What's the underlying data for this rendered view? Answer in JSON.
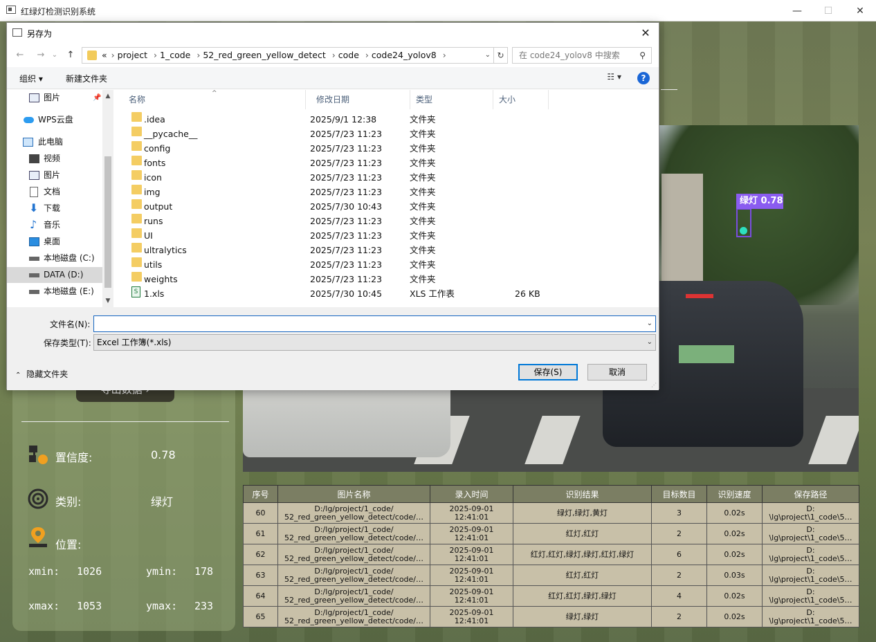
{
  "window": {
    "title": "红绿灯检测识别系统",
    "min_glyph": "—",
    "max_glyph": "☐",
    "close_glyph": "✕"
  },
  "app": {
    "export_button": "导出数据 ›",
    "confidence_label": "置信度:",
    "confidence_value": "0.78",
    "class_label": "类别:",
    "class_value": "绿灯",
    "position_label": "位置:",
    "xmin_label": "xmin:",
    "xmin_value": "1026",
    "ymin_label": "ymin:",
    "ymin_value": "178",
    "xmax_label": "xmax:",
    "xmax_value": "1053",
    "ymax_label": "ymax:",
    "ymax_value": "233",
    "detection_label": "绿灯 0.78",
    "table": {
      "headers": [
        "序号",
        "图片名称",
        "录入时间",
        "识别结果",
        "目标数目",
        "识别速度",
        "保存路径"
      ],
      "rows": [
        {
          "id": "60",
          "name1": "D:/lg/project/1_code/",
          "name2": "52_red_green_yellow_detect/code/…",
          "time1": "2025-09-01",
          "time2": "12:41:01",
          "result": "绿灯,绿灯,黄灯",
          "count": "3",
          "speed": "0.02s",
          "path1": "D:",
          "path2": "\\lg\\project\\1_code\\5…"
        },
        {
          "id": "61",
          "name1": "D:/lg/project/1_code/",
          "name2": "52_red_green_yellow_detect/code/…",
          "time1": "2025-09-01",
          "time2": "12:41:01",
          "result": "红灯,红灯",
          "count": "2",
          "speed": "0.02s",
          "path1": "D:",
          "path2": "\\lg\\project\\1_code\\5…"
        },
        {
          "id": "62",
          "name1": "D:/lg/project/1_code/",
          "name2": "52_red_green_yellow_detect/code/…",
          "time1": "2025-09-01",
          "time2": "12:41:01",
          "result": "红灯,红灯,绿灯,绿灯,红灯,绿灯",
          "count": "6",
          "speed": "0.02s",
          "path1": "D:",
          "path2": "\\lg\\project\\1_code\\5…"
        },
        {
          "id": "63",
          "name1": "D:/lg/project/1_code/",
          "name2": "52_red_green_yellow_detect/code/…",
          "time1": "2025-09-01",
          "time2": "12:41:01",
          "result": "红灯,红灯",
          "count": "2",
          "speed": "0.03s",
          "path1": "D:",
          "path2": "\\lg\\project\\1_code\\5…"
        },
        {
          "id": "64",
          "name1": "D:/lg/project/1_code/",
          "name2": "52_red_green_yellow_detect/code/…",
          "time1": "2025-09-01",
          "time2": "12:41:01",
          "result": "红灯,红灯,绿灯,绿灯",
          "count": "4",
          "speed": "0.02s",
          "path1": "D:",
          "path2": "\\lg\\project\\1_code\\5…"
        },
        {
          "id": "65",
          "name1": "D:/lg/project/1_code/",
          "name2": "52_red_green_yellow_detect/code/…",
          "time1": "2025-09-01",
          "time2": "12:41:01",
          "result": "绿灯,绿灯",
          "count": "2",
          "speed": "0.02s",
          "path1": "D:",
          "path2": "\\lg\\project\\1_code\\5…"
        }
      ]
    }
  },
  "dialog": {
    "title": "另存为",
    "close_glyph": "✕",
    "nav": {
      "back": "←",
      "forward": "→",
      "recent": "⌄",
      "up": "↑",
      "refresh": "↻",
      "dropdown": "⌄"
    },
    "breadcrumb": [
      "«",
      "project",
      "1_code",
      "52_red_green_yellow_detect",
      "code",
      "code24_yolov8"
    ],
    "search_placeholder": "在 code24_yolov8 中搜索",
    "toolbar": {
      "organize": "组织 ▾",
      "new_folder": "新建文件夹",
      "view": "☷ ▾",
      "help": "?"
    },
    "nav_items": [
      {
        "label": "图片",
        "icon": "pictures-icon"
      },
      {
        "label": "WPS云盘",
        "icon": "cloud-icon"
      },
      {
        "label": "此电脑",
        "icon": "computer-icon"
      },
      {
        "label": "视频",
        "icon": "video-icon"
      },
      {
        "label": "图片",
        "icon": "pictures-icon"
      },
      {
        "label": "文档",
        "icon": "document-icon"
      },
      {
        "label": "下载",
        "icon": "download-icon"
      },
      {
        "label": "音乐",
        "icon": "music-icon"
      },
      {
        "label": "桌面",
        "icon": "desktop-icon"
      },
      {
        "label": "本地磁盘 (C:)",
        "icon": "drive-icon"
      },
      {
        "label": "DATA (D:)",
        "icon": "drive-icon"
      },
      {
        "label": "本地磁盘 (E:)",
        "icon": "drive-icon"
      }
    ],
    "columns": {
      "name": "名称",
      "date": "修改日期",
      "type": "类型",
      "size": "大小"
    },
    "files": [
      {
        "name": ".idea",
        "date": "2025/9/1 12:38",
        "type": "文件夹",
        "size": "",
        "kind": "folder"
      },
      {
        "name": "__pycache__",
        "date": "2025/7/23 11:23",
        "type": "文件夹",
        "size": "",
        "kind": "folder"
      },
      {
        "name": "config",
        "date": "2025/7/23 11:23",
        "type": "文件夹",
        "size": "",
        "kind": "folder"
      },
      {
        "name": "fonts",
        "date": "2025/7/23 11:23",
        "type": "文件夹",
        "size": "",
        "kind": "folder"
      },
      {
        "name": "icon",
        "date": "2025/7/23 11:23",
        "type": "文件夹",
        "size": "",
        "kind": "folder"
      },
      {
        "name": "img",
        "date": "2025/7/23 11:23",
        "type": "文件夹",
        "size": "",
        "kind": "folder"
      },
      {
        "name": "output",
        "date": "2025/7/30 10:43",
        "type": "文件夹",
        "size": "",
        "kind": "folder"
      },
      {
        "name": "runs",
        "date": "2025/7/23 11:23",
        "type": "文件夹",
        "size": "",
        "kind": "folder"
      },
      {
        "name": "UI",
        "date": "2025/7/23 11:23",
        "type": "文件夹",
        "size": "",
        "kind": "folder"
      },
      {
        "name": "ultralytics",
        "date": "2025/7/23 11:23",
        "type": "文件夹",
        "size": "",
        "kind": "folder"
      },
      {
        "name": "utils",
        "date": "2025/7/23 11:23",
        "type": "文件夹",
        "size": "",
        "kind": "folder"
      },
      {
        "name": "weights",
        "date": "2025/7/23 11:23",
        "type": "文件夹",
        "size": "",
        "kind": "folder"
      },
      {
        "name": "1.xls",
        "date": "2025/7/30 10:45",
        "type": "XLS 工作表",
        "size": "26 KB",
        "kind": "xls"
      }
    ],
    "filename_label": "文件名(N):",
    "filename_value": "",
    "filetype_label": "保存类型(T):",
    "filetype_value": "Excel 工作簿(*.xls)",
    "save_button": "保存(S)",
    "cancel_button": "取消",
    "hide_folders": "隐藏文件夹"
  }
}
